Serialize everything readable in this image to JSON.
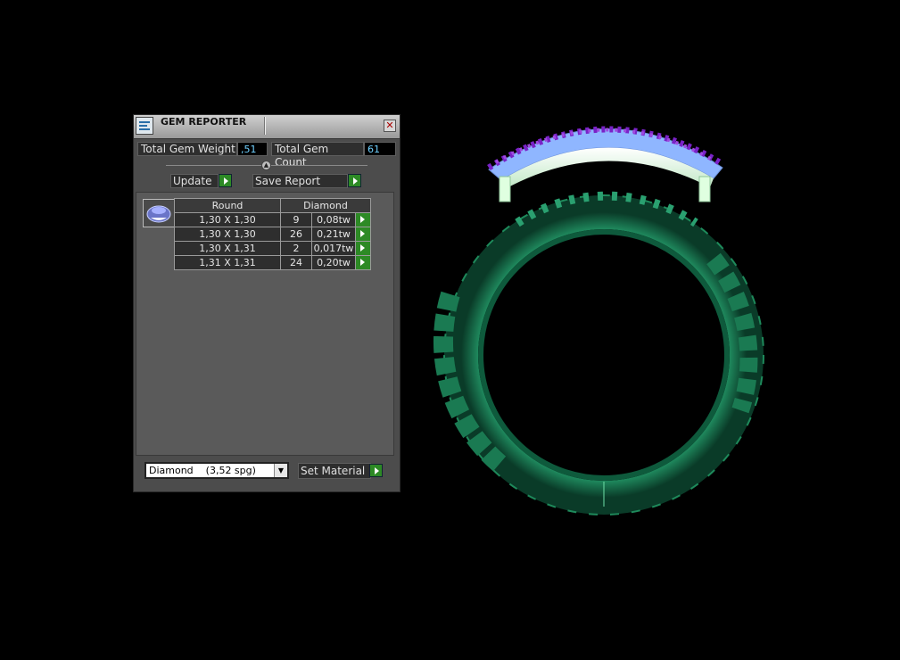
{
  "panel": {
    "title": "GEM REPORTER",
    "close_label": "✕",
    "total_weight_label": "Total Gem Weight",
    "total_weight_value": ",51",
    "total_count_label": "Total Gem Count",
    "total_count_value": "61",
    "update_label": "Update",
    "save_report_label": "Save Report",
    "table": {
      "shape_header": "Round",
      "material_header": "Diamond",
      "rows": [
        {
          "size": "1,30 X 1,30",
          "count": "9",
          "weight": "0,08tw"
        },
        {
          "size": "1,30 X 1,30",
          "count": "26",
          "weight": "0,21tw"
        },
        {
          "size": "1,30 X 1,31",
          "count": "2",
          "weight": "0,017tw"
        },
        {
          "size": "1,31 X 1,31",
          "count": "24",
          "weight": "0,20tw"
        }
      ]
    },
    "material_select_value": "Diamond    (3,52 spg)",
    "set_material_label": "Set Material"
  },
  "colors": {
    "ring_green": "#1f8a5e",
    "gem_purple": "#7a22c8",
    "metal_white": "#dfffe0",
    "value_cyan": "#6fd0ff",
    "arrow_green": "#2d8a25"
  }
}
